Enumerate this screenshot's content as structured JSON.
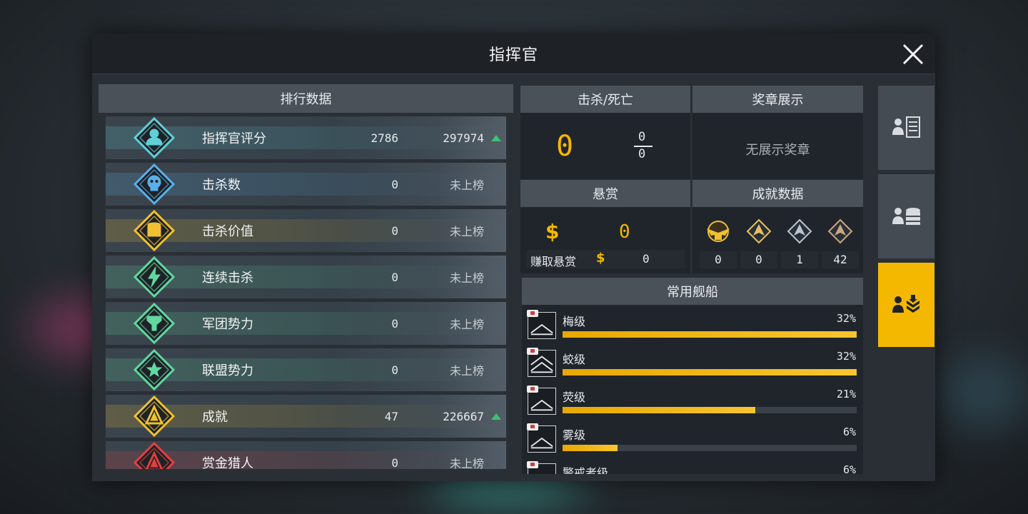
{
  "dialog": {
    "title": "指挥官"
  },
  "ranking": {
    "header": "排行数据",
    "rows": [
      {
        "name": "指挥官评分",
        "value": "2786",
        "rank": "297974",
        "ranked": true,
        "trend": "up",
        "color": "#5fd0d8",
        "icon": "commander-avatar-icon"
      },
      {
        "name": "击杀数",
        "value": "0",
        "rank": "未上榜",
        "ranked": false,
        "color": "#5ab0e8",
        "icon": "skull-icon"
      },
      {
        "name": "击杀价值",
        "value": "0",
        "rank": "未上榜",
        "ranked": false,
        "color": "#f0c030",
        "icon": "coin-stack-icon"
      },
      {
        "name": "连续击杀",
        "value": "0",
        "rank": "未上榜",
        "ranked": false,
        "color": "#60d8a0",
        "icon": "lightning-icon"
      },
      {
        "name": "军团势力",
        "value": "0",
        "rank": "未上榜",
        "ranked": false,
        "color": "#60d8a0",
        "icon": "legion-emblem-icon"
      },
      {
        "name": "联盟势力",
        "value": "0",
        "rank": "未上榜",
        "ranked": false,
        "color": "#60d8a0",
        "icon": "alliance-star-icon"
      },
      {
        "name": "成就",
        "value": "47",
        "rank": "226667",
        "ranked": true,
        "trend": "up",
        "color": "#f0c030",
        "icon": "achievement-triangle-icon"
      },
      {
        "name": "赏金猎人",
        "value": "0",
        "rank": "未上榜",
        "ranked": false,
        "color": "#e04040",
        "icon": "bounty-hunter-icon"
      }
    ]
  },
  "kd": {
    "header": "击杀/死亡",
    "ratio": "0",
    "kills": "0",
    "deaths": "0"
  },
  "medals": {
    "header": "奖章展示",
    "empty_text": "无展示奖章"
  },
  "bounty": {
    "header": "悬赏",
    "currency": "$",
    "amount": "0",
    "earned_label": "赚取悬赏",
    "earned_amount": "0"
  },
  "achievements": {
    "header": "成就数据",
    "tiers": [
      {
        "icon": "eagle-crest-icon",
        "count": "0"
      },
      {
        "icon": "gold-chevron-icon",
        "count": "0"
      },
      {
        "icon": "silver-chevron-icon",
        "count": "1"
      },
      {
        "icon": "bronze-chevron-icon",
        "count": "42"
      }
    ]
  },
  "ships": {
    "header": "常用舰船",
    "items": [
      {
        "name": "梅级",
        "pct": "32%",
        "value": 0.32,
        "chevrons": 1
      },
      {
        "name": "蛟级",
        "pct": "32%",
        "value": 0.32,
        "chevrons": 2
      },
      {
        "name": "荧级",
        "pct": "21%",
        "value": 0.21,
        "chevrons": 1
      },
      {
        "name": "雾级",
        "pct": "6%",
        "value": 0.06,
        "chevrons": 1
      },
      {
        "name": "警戒者级",
        "pct": "6%",
        "value": 0.06,
        "chevrons": 1
      }
    ]
  },
  "tabs": [
    {
      "name": "profile-list-tab",
      "active": false
    },
    {
      "name": "profile-data-tab",
      "active": false
    },
    {
      "name": "profile-fleet-tab",
      "active": true
    }
  ],
  "colors": {
    "accent": "#f5b800",
    "panel": "#2a2f36",
    "header": "#4a5159"
  }
}
